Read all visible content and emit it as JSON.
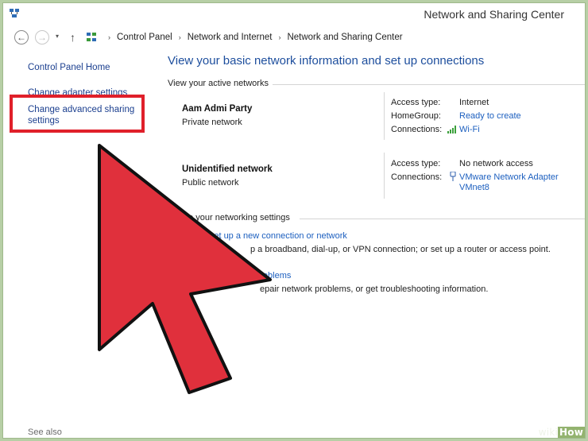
{
  "window": {
    "title": "Network and Sharing Center"
  },
  "addressbar": {
    "back_glyph": "←",
    "forward_glyph": "→",
    "dropdown_glyph": "▾",
    "up_glyph": "↑",
    "separator": "›",
    "crumbs": [
      "Control Panel",
      "Network and Internet",
      "Network and Sharing Center"
    ]
  },
  "sidebar": {
    "home": "Control Panel Home",
    "adapter": "Change adapter settings",
    "advanced": "Change advanced sharing settings",
    "see_also": "See also"
  },
  "main": {
    "title": "View your basic network information and set up connections",
    "active_networks_heading": "View your active networks",
    "networks": [
      {
        "name": "Aam Admi Party",
        "type": "Private network",
        "props": [
          {
            "label": "Access type:",
            "value": "Internet"
          },
          {
            "label": "HomeGroup:",
            "value": "Ready to create"
          },
          {
            "label": "Connections:",
            "value": "Wi-Fi"
          }
        ]
      },
      {
        "name": "Unidentified network",
        "type": "Public network",
        "props": [
          {
            "label": "Access type:",
            "value": "No network access"
          },
          {
            "label": "Connections:",
            "value": "VMware Network Adapter",
            "value2": "VMnet8"
          }
        ]
      }
    ],
    "change_settings_heading": "ge your networking settings",
    "tasks": [
      {
        "link": "Set up a new connection or network",
        "desc": "p a broadband, dial-up, or VPN connection; or set up a router or access point."
      },
      {
        "link": "t problems",
        "desc": "epair network problems, or get troubleshooting information."
      }
    ]
  },
  "overlay": {
    "arrow_color": "#e0303c",
    "highlight_color": "#e0202a"
  },
  "watermark": {
    "wiki": "wiki",
    "how": "How"
  }
}
